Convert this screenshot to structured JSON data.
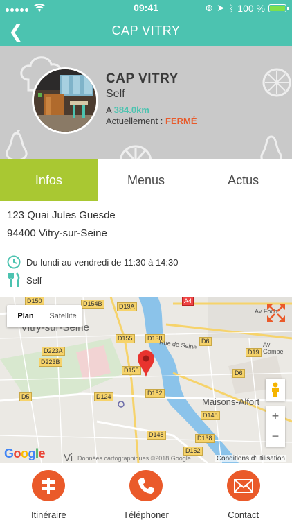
{
  "status_bar": {
    "time": "09:41",
    "battery": "100 %"
  },
  "header": {
    "back_glyph": "❮",
    "title": "CAP VITRY"
  },
  "profile": {
    "name": "CAP VITRY",
    "type": "Self",
    "distance_prefix": "A",
    "distance_value": "384.0km",
    "status_prefix": "Actuellement :",
    "status_value": "FERMÉ"
  },
  "tabs": [
    {
      "label": "Infos",
      "active": true
    },
    {
      "label": "Menus",
      "active": false
    },
    {
      "label": "Actus",
      "active": false
    }
  ],
  "info": {
    "address_line1": "123 Quai Jules Guesde",
    "address_line2": "94400 Vitry-sur-Seine",
    "hours": "Du lundi au vendredi de 11:30 à 14:30",
    "service_type": "Self"
  },
  "map": {
    "type_selected": "Plan",
    "type_other": "Satellite",
    "places": [
      "Vitry-sur-Seine",
      "Maisons-Alfort",
      "Rue de Seine",
      "Av Foch",
      "Av Gambe",
      "Vi"
    ],
    "roads": [
      "D150",
      "D154B",
      "D19A",
      "A4",
      "D155",
      "D138",
      "D6",
      "D223A",
      "D223B",
      "D155",
      "D19",
      "D152",
      "D124",
      "D5",
      "D6",
      "D148",
      "D148",
      "D138",
      "D152"
    ],
    "zoom_in": "+",
    "zoom_out": "−",
    "logo": "Google",
    "credits": "Données cartographiques ©2018 Google",
    "terms": "Conditions d'utilisation"
  },
  "actions": [
    {
      "label": "Itinéraire",
      "icon": "signpost-icon"
    },
    {
      "label": "Téléphoner",
      "icon": "phone-icon"
    },
    {
      "label": "Contact",
      "icon": "mail-icon"
    }
  ],
  "colors": {
    "accent": "#4cc3b0",
    "tab_active": "#a9c832",
    "action": "#ea5a2a",
    "closed": "#e85a2a"
  }
}
